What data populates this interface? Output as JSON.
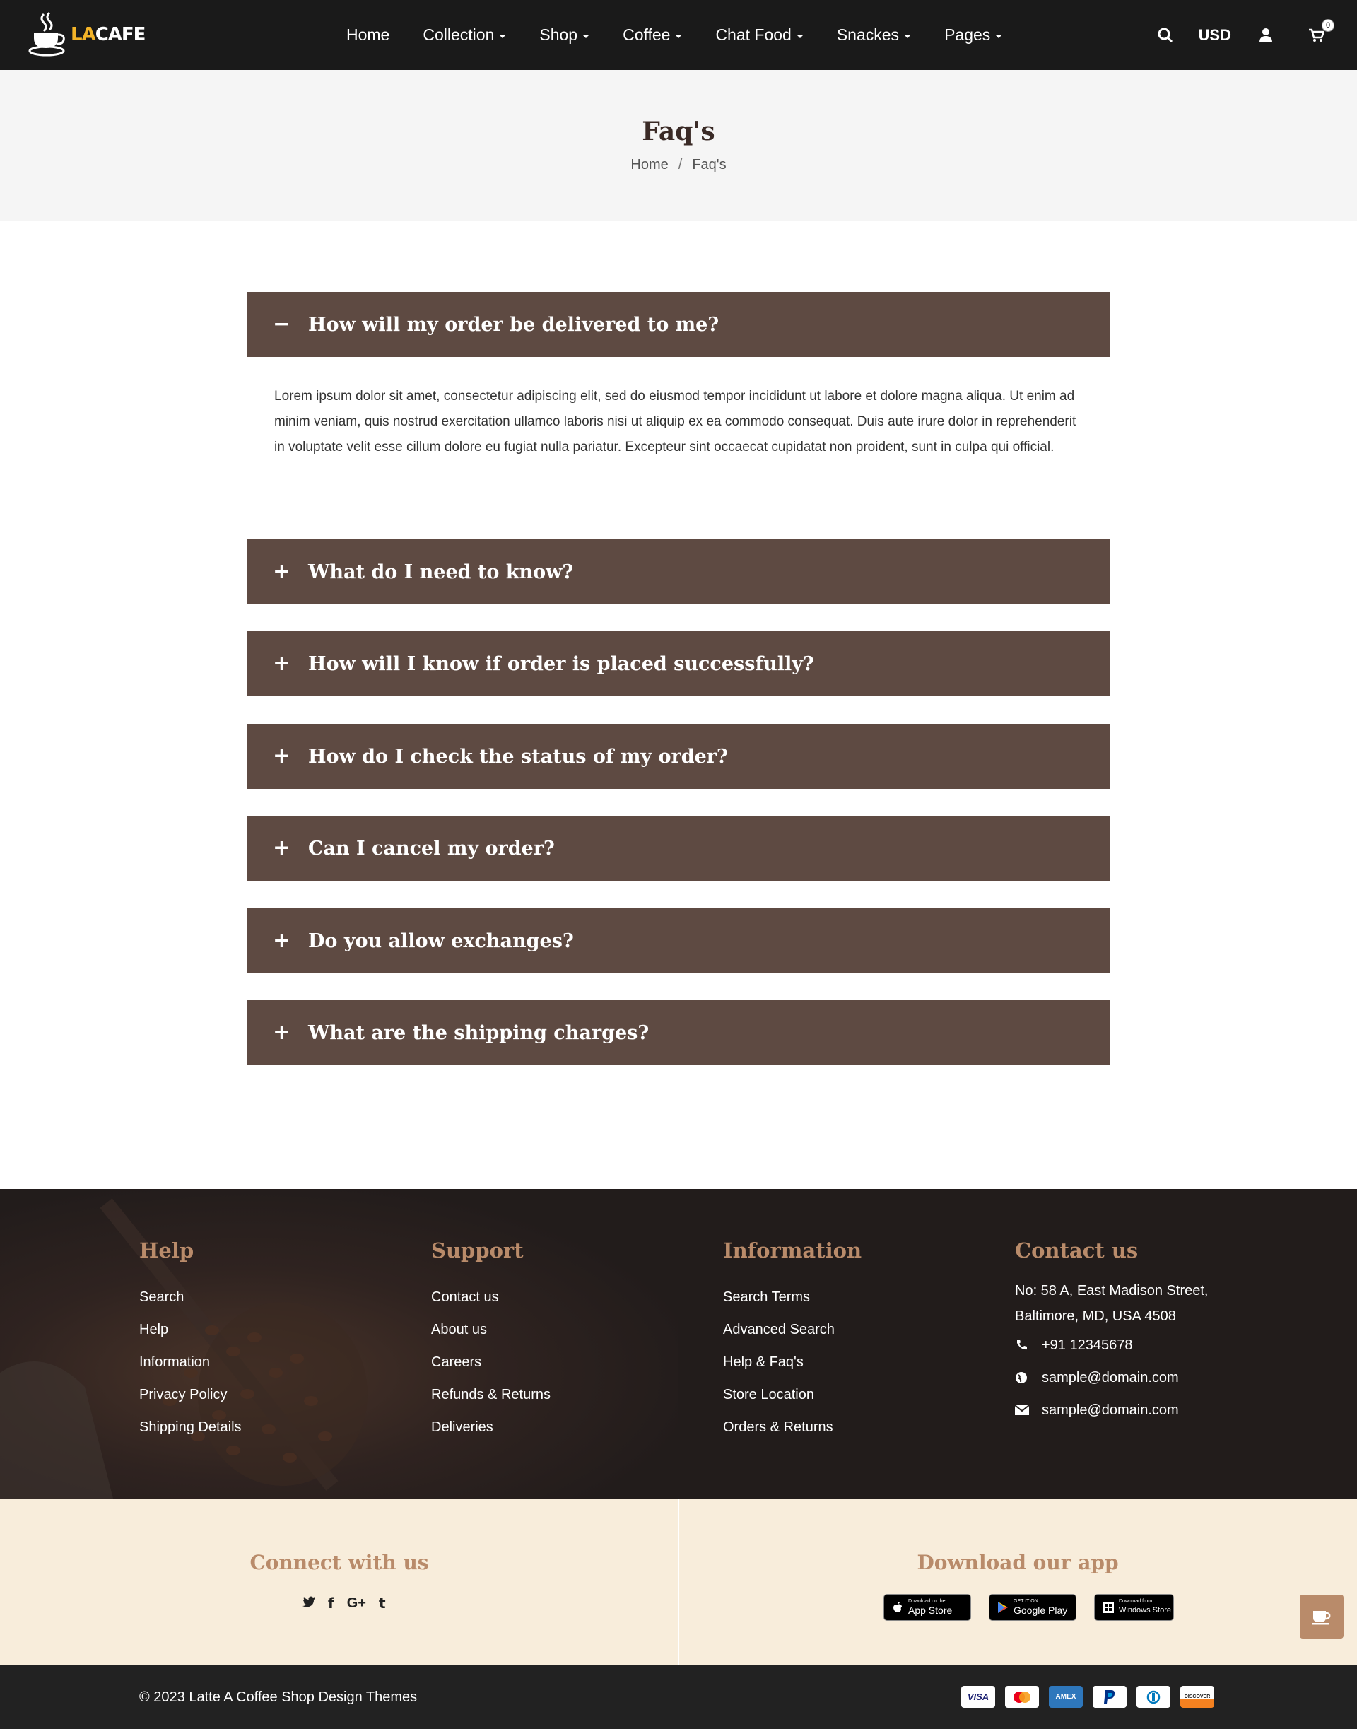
{
  "header": {
    "logo": {
      "part1": "LA",
      "part2": "CAFE"
    },
    "nav": [
      {
        "label": "Home",
        "dropdown": false
      },
      {
        "label": "Collection",
        "dropdown": true
      },
      {
        "label": "Shop",
        "dropdown": true
      },
      {
        "label": "Coffee",
        "dropdown": true
      },
      {
        "label": "Chat Food",
        "dropdown": true
      },
      {
        "label": "Snackes",
        "dropdown": true
      },
      {
        "label": "Pages",
        "dropdown": true
      }
    ],
    "currency": "USD",
    "cart_count": "0",
    "icons": [
      "search-icon",
      "user-icon",
      "cart-icon"
    ]
  },
  "page": {
    "title": "Faq's",
    "breadcrumb": {
      "home": "Home",
      "separator": "/",
      "current": "Faq's"
    }
  },
  "faq": {
    "items": [
      {
        "question": "How will my order be delivered to me?",
        "expanded": true,
        "sign": "−",
        "answer": "Lorem ipsum dolor sit amet, consectetur adipiscing elit, sed do eiusmod tempor incididunt ut labore et dolore magna aliqua. Ut enim ad minim veniam, quis nostrud exercitation ullamco laboris nisi ut aliquip ex ea commodo consequat. Duis aute irure dolor in reprehenderit in voluptate velit esse cillum dolore eu fugiat nulla pariatur. Excepteur sint occaecat cupidatat non proident, sunt in culpa qui official."
      },
      {
        "question": "What do I need to know?",
        "expanded": false,
        "sign": "+"
      },
      {
        "question": "How will I know if order is placed successfully?",
        "expanded": false,
        "sign": "+"
      },
      {
        "question": "How do I check the status of my order?",
        "expanded": false,
        "sign": "+"
      },
      {
        "question": "Can I cancel my order?",
        "expanded": false,
        "sign": "+"
      },
      {
        "question": "Do you allow exchanges?",
        "expanded": false,
        "sign": "+"
      },
      {
        "question": "What are the shipping charges?",
        "expanded": false,
        "sign": "+"
      }
    ]
  },
  "footer": {
    "help": {
      "title": "Help",
      "links": [
        "Search",
        "Help",
        "Information",
        "Privacy Policy",
        "Shipping Details"
      ]
    },
    "support": {
      "title": "Support",
      "links": [
        "Contact us",
        "About us",
        "Careers",
        "Refunds & Returns",
        "Deliveries"
      ]
    },
    "information": {
      "title": "Information",
      "links": [
        "Search Terms",
        "Advanced Search",
        "Help & Faq's",
        "Store Location",
        "Orders & Returns"
      ]
    },
    "contact": {
      "title": "Contact us",
      "address_line1": "No: 58 A, East Madison Street,",
      "address_line2": "Baltimore, MD, USA 4508",
      "phone": "+91 12345678",
      "web": "sample@domain.com",
      "email": "sample@domain.com"
    }
  },
  "connect": {
    "title": "Connect with us",
    "socials": [
      {
        "name": "twitter-icon",
        "glyph": "🐦"
      },
      {
        "name": "facebook-icon",
        "glyph": "f"
      },
      {
        "name": "google-plus-icon",
        "glyph": "G+"
      },
      {
        "name": "tumblr-icon",
        "glyph": "t"
      }
    ]
  },
  "download": {
    "title": "Download our app",
    "apps": [
      {
        "small": "Download on the",
        "big": "App Store"
      },
      {
        "small": "GET IT ON",
        "big": "Google Play"
      },
      {
        "small": "Download from",
        "big": "Windows Store"
      }
    ]
  },
  "bottom": {
    "copyright": "© 2023 Latte A Coffee Shop Design Themes",
    "payments": [
      "VISA",
      "",
      "AMEX",
      "",
      "",
      "DISCOVER"
    ]
  },
  "colors": {
    "header_bg": "#1a1a1a",
    "accent": "#b98b6a",
    "faq_bg": "#5e4a42",
    "logo_yellow": "#f4b428",
    "cream": "#f8eddb"
  }
}
